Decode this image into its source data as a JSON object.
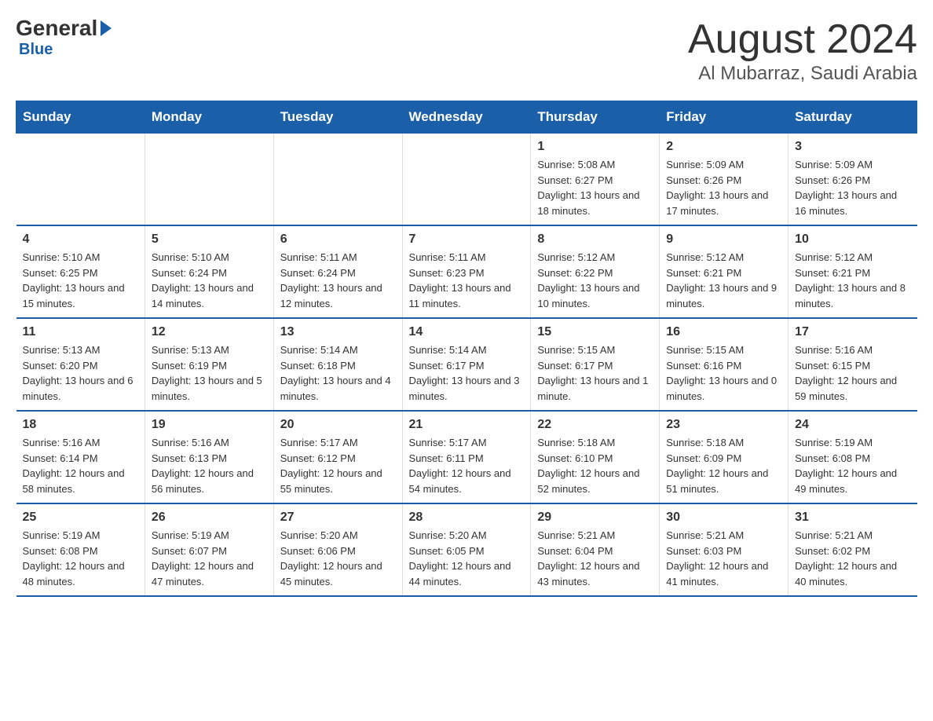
{
  "header": {
    "logo_general": "General",
    "logo_blue": "Blue",
    "title": "August 2024",
    "subtitle": "Al Mubarraz, Saudi Arabia"
  },
  "weekdays": [
    "Sunday",
    "Monday",
    "Tuesday",
    "Wednesday",
    "Thursday",
    "Friday",
    "Saturday"
  ],
  "weeks": [
    [
      {
        "day": "",
        "info": ""
      },
      {
        "day": "",
        "info": ""
      },
      {
        "day": "",
        "info": ""
      },
      {
        "day": "",
        "info": ""
      },
      {
        "day": "1",
        "info": "Sunrise: 5:08 AM\nSunset: 6:27 PM\nDaylight: 13 hours and 18 minutes."
      },
      {
        "day": "2",
        "info": "Sunrise: 5:09 AM\nSunset: 6:26 PM\nDaylight: 13 hours and 17 minutes."
      },
      {
        "day": "3",
        "info": "Sunrise: 5:09 AM\nSunset: 6:26 PM\nDaylight: 13 hours and 16 minutes."
      }
    ],
    [
      {
        "day": "4",
        "info": "Sunrise: 5:10 AM\nSunset: 6:25 PM\nDaylight: 13 hours and 15 minutes."
      },
      {
        "day": "5",
        "info": "Sunrise: 5:10 AM\nSunset: 6:24 PM\nDaylight: 13 hours and 14 minutes."
      },
      {
        "day": "6",
        "info": "Sunrise: 5:11 AM\nSunset: 6:24 PM\nDaylight: 13 hours and 12 minutes."
      },
      {
        "day": "7",
        "info": "Sunrise: 5:11 AM\nSunset: 6:23 PM\nDaylight: 13 hours and 11 minutes."
      },
      {
        "day": "8",
        "info": "Sunrise: 5:12 AM\nSunset: 6:22 PM\nDaylight: 13 hours and 10 minutes."
      },
      {
        "day": "9",
        "info": "Sunrise: 5:12 AM\nSunset: 6:21 PM\nDaylight: 13 hours and 9 minutes."
      },
      {
        "day": "10",
        "info": "Sunrise: 5:12 AM\nSunset: 6:21 PM\nDaylight: 13 hours and 8 minutes."
      }
    ],
    [
      {
        "day": "11",
        "info": "Sunrise: 5:13 AM\nSunset: 6:20 PM\nDaylight: 13 hours and 6 minutes."
      },
      {
        "day": "12",
        "info": "Sunrise: 5:13 AM\nSunset: 6:19 PM\nDaylight: 13 hours and 5 minutes."
      },
      {
        "day": "13",
        "info": "Sunrise: 5:14 AM\nSunset: 6:18 PM\nDaylight: 13 hours and 4 minutes."
      },
      {
        "day": "14",
        "info": "Sunrise: 5:14 AM\nSunset: 6:17 PM\nDaylight: 13 hours and 3 minutes."
      },
      {
        "day": "15",
        "info": "Sunrise: 5:15 AM\nSunset: 6:17 PM\nDaylight: 13 hours and 1 minute."
      },
      {
        "day": "16",
        "info": "Sunrise: 5:15 AM\nSunset: 6:16 PM\nDaylight: 13 hours and 0 minutes."
      },
      {
        "day": "17",
        "info": "Sunrise: 5:16 AM\nSunset: 6:15 PM\nDaylight: 12 hours and 59 minutes."
      }
    ],
    [
      {
        "day": "18",
        "info": "Sunrise: 5:16 AM\nSunset: 6:14 PM\nDaylight: 12 hours and 58 minutes."
      },
      {
        "day": "19",
        "info": "Sunrise: 5:16 AM\nSunset: 6:13 PM\nDaylight: 12 hours and 56 minutes."
      },
      {
        "day": "20",
        "info": "Sunrise: 5:17 AM\nSunset: 6:12 PM\nDaylight: 12 hours and 55 minutes."
      },
      {
        "day": "21",
        "info": "Sunrise: 5:17 AM\nSunset: 6:11 PM\nDaylight: 12 hours and 54 minutes."
      },
      {
        "day": "22",
        "info": "Sunrise: 5:18 AM\nSunset: 6:10 PM\nDaylight: 12 hours and 52 minutes."
      },
      {
        "day": "23",
        "info": "Sunrise: 5:18 AM\nSunset: 6:09 PM\nDaylight: 12 hours and 51 minutes."
      },
      {
        "day": "24",
        "info": "Sunrise: 5:19 AM\nSunset: 6:08 PM\nDaylight: 12 hours and 49 minutes."
      }
    ],
    [
      {
        "day": "25",
        "info": "Sunrise: 5:19 AM\nSunset: 6:08 PM\nDaylight: 12 hours and 48 minutes."
      },
      {
        "day": "26",
        "info": "Sunrise: 5:19 AM\nSunset: 6:07 PM\nDaylight: 12 hours and 47 minutes."
      },
      {
        "day": "27",
        "info": "Sunrise: 5:20 AM\nSunset: 6:06 PM\nDaylight: 12 hours and 45 minutes."
      },
      {
        "day": "28",
        "info": "Sunrise: 5:20 AM\nSunset: 6:05 PM\nDaylight: 12 hours and 44 minutes."
      },
      {
        "day": "29",
        "info": "Sunrise: 5:21 AM\nSunset: 6:04 PM\nDaylight: 12 hours and 43 minutes."
      },
      {
        "day": "30",
        "info": "Sunrise: 5:21 AM\nSunset: 6:03 PM\nDaylight: 12 hours and 41 minutes."
      },
      {
        "day": "31",
        "info": "Sunrise: 5:21 AM\nSunset: 6:02 PM\nDaylight: 12 hours and 40 minutes."
      }
    ]
  ]
}
